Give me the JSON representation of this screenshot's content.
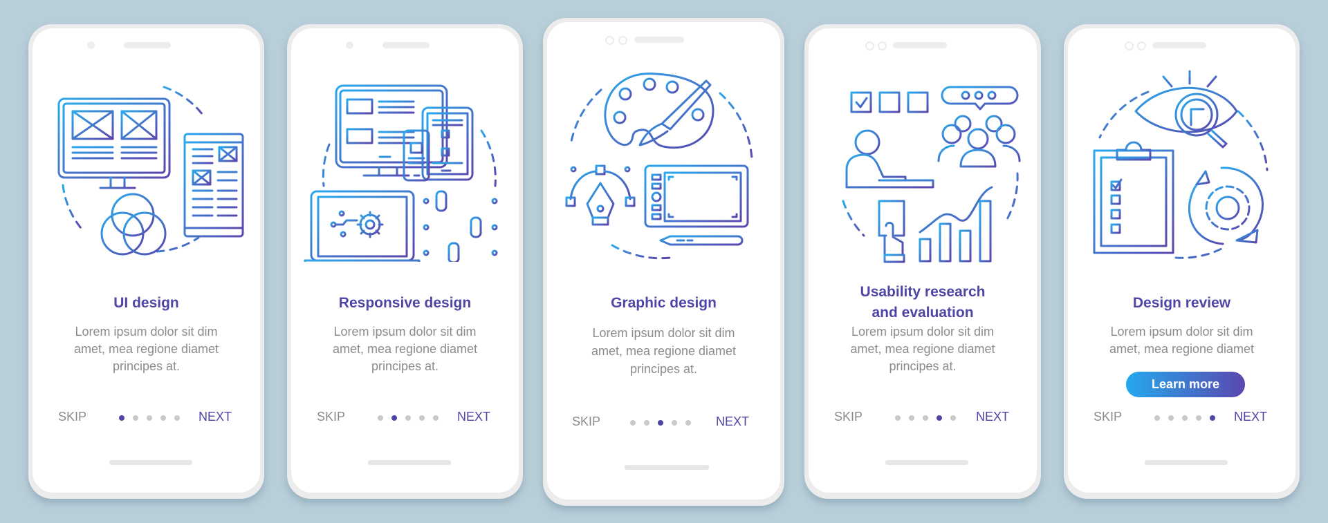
{
  "colors": {
    "background": "#b8ced9",
    "title": "#4f45a5",
    "body_text": "#8b8b8e",
    "dot_inactive": "#c9c9c9",
    "dot_active": "#4f45a5",
    "icon_gradient_start": "#2aa8ec",
    "icon_gradient_end": "#5a47ae"
  },
  "screens": [
    {
      "title": "UI design",
      "body": "Lorem ipsum dolor sit dim amet, mea regione diamet principes at.",
      "skip_label": "SKIP",
      "next_label": "NEXT",
      "page_index": 1,
      "page_count": 5,
      "illustration": "ui-design-illustration"
    },
    {
      "title": "Responsive design",
      "body": "Lorem ipsum dolor sit dim amet, mea regione diamet principes at.",
      "skip_label": "SKIP",
      "next_label": "NEXT",
      "page_index": 2,
      "page_count": 5,
      "illustration": "responsive-design-illustration"
    },
    {
      "title": "Graphic design",
      "body": "Lorem ipsum dolor sit dim amet, mea regione diamet principes at.",
      "skip_label": "SKIP",
      "next_label": "NEXT",
      "page_index": 3,
      "page_count": 5,
      "illustration": "graphic-design-illustration"
    },
    {
      "title_line1": "Usability research",
      "title_line2": "and evaluation",
      "body": "Lorem ipsum dolor sit dim amet, mea regione diamet principes at.",
      "skip_label": "SKIP",
      "next_label": "NEXT",
      "page_index": 4,
      "page_count": 5,
      "illustration": "usability-research-illustration"
    },
    {
      "title": "Design review",
      "body": "Lorem ipsum dolor sit dim amet, mea regione diamet",
      "button_label": "Learn more",
      "skip_label": "SKIP",
      "next_label": "NEXT",
      "page_index": 5,
      "page_count": 5,
      "illustration": "design-review-illustration"
    }
  ]
}
